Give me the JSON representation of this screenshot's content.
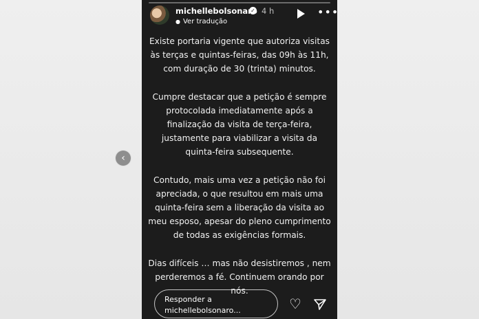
{
  "story": {
    "username": "michellebolsonaro",
    "timestamp": "4 h",
    "translate_label": "Ver tradução",
    "paragraphs": [
      "Existe portaria vigente que autoriza visitas às terças e quintas-feiras, das 09h às 11h, com duração de 30 (trinta) minutos.",
      "Cumpre destacar que a petição é sempre protocolada imediatamente após a finalização da visita de terça-feira, justamente para viabilizar a visita da quinta-feira subsequente.",
      "Contudo, mais uma vez a petição não foi apreciada, o que resultou em mais uma quinta-feira sem a liberação da visita ao meu esposo, apesar do pleno cumprimento de todas as exigências formais.",
      "Dias difíceis … mas não desistiremos , nem perderemos a fé. Continuem orando por nós."
    ],
    "reply_placeholder": "Responder a michellebolsonaro..."
  },
  "icons": {
    "prev": "chevron-left-icon",
    "verified": "verified-badge-icon",
    "translate": "translate-icon",
    "play": "play-icon",
    "more": "more-icon",
    "heart": "heart-icon",
    "send": "send-icon"
  },
  "colors": {
    "story_bg": "#1c1c1c",
    "page_bg": "#ececec",
    "text": "#f2f2f2"
  }
}
